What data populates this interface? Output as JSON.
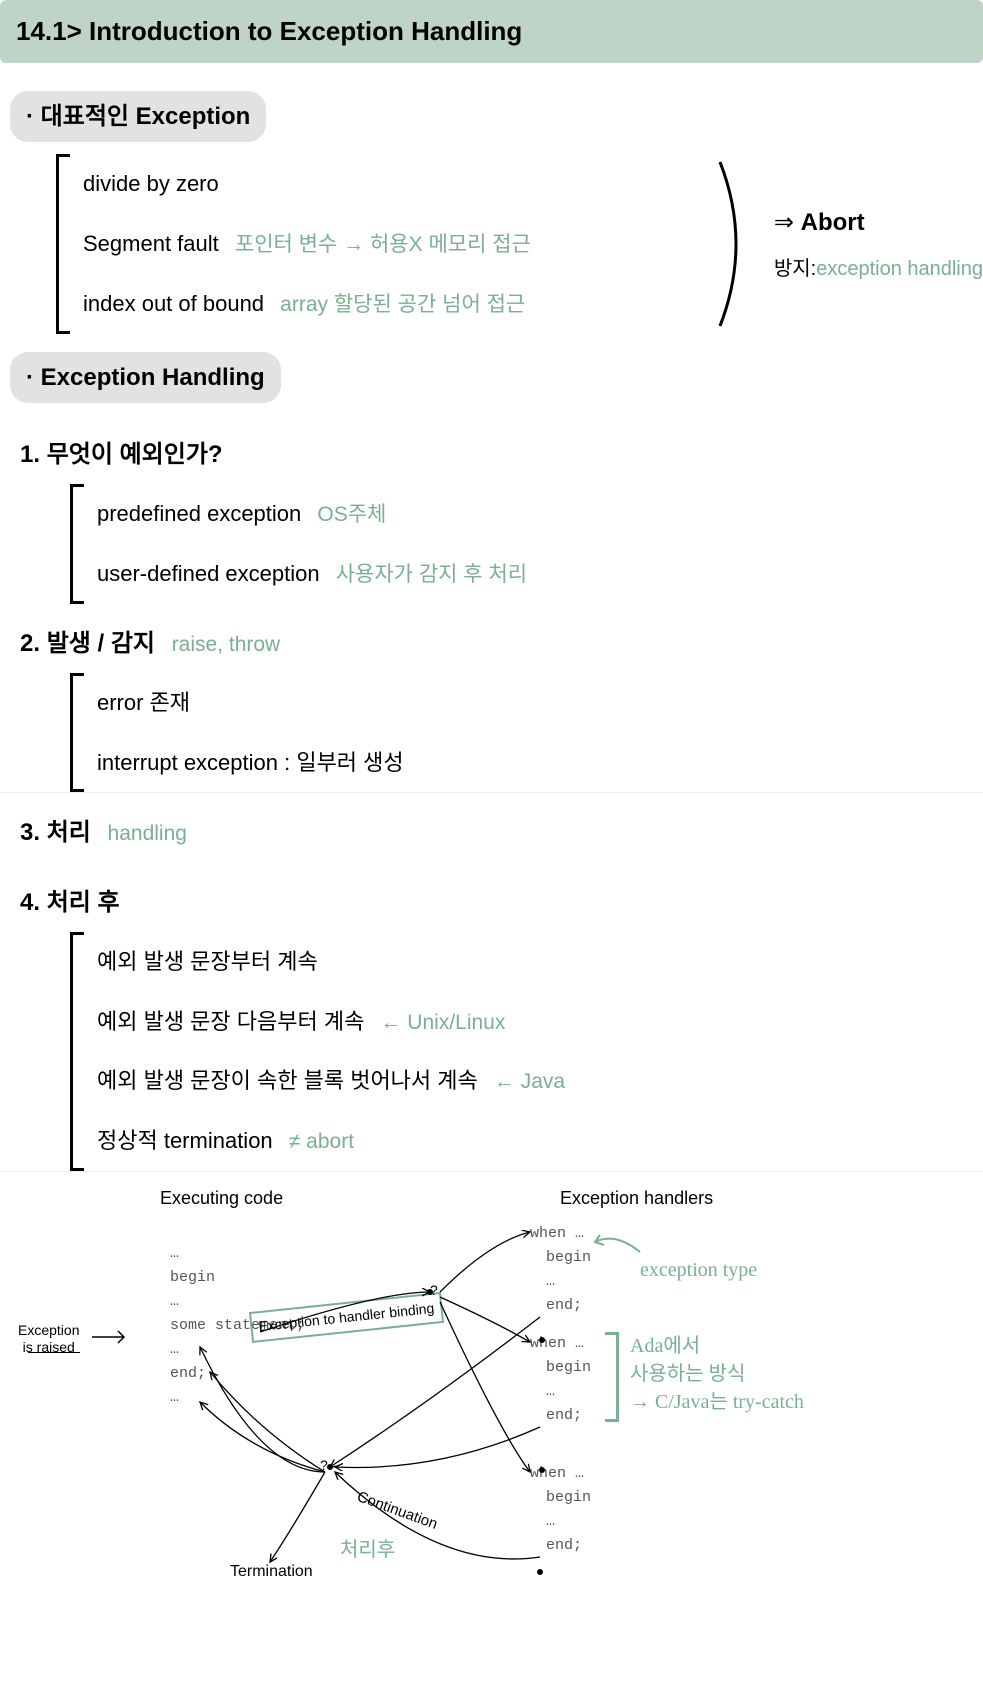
{
  "title": "14.1> Introduction to Exception Handling",
  "section1": {
    "heading": "· 대표적인 Exception",
    "items": [
      {
        "text": "divide by zero",
        "note": ""
      },
      {
        "text": "Segment fault",
        "note": "포인터 변수 → 허용X 메모리 접근"
      },
      {
        "text": "index out of bound",
        "note": "array 할당된 공간 넘어 접근"
      }
    ],
    "result": {
      "arrow": "⇒",
      "main": "Abort",
      "sub_prefix": "방지:",
      "sub": "exception handling"
    }
  },
  "section2": {
    "heading": "· Exception Handling",
    "q1": {
      "num": "1.",
      "title": "무엇이 예외인가?",
      "items": [
        {
          "text": "predefined exception",
          "note": "OS주체"
        },
        {
          "text": "user-defined exception",
          "note": "사용자가 감지 후 처리"
        }
      ]
    },
    "q2": {
      "num": "2.",
      "title": "발생 / 감지",
      "note": "raise, throw",
      "items": [
        {
          "text": "error 존재"
        },
        {
          "text": "interrupt exception : 일부러 생성"
        }
      ]
    },
    "q3": {
      "num": "3.",
      "title": "처리",
      "note": "handling"
    },
    "q4": {
      "num": "4.",
      "title": "처리 후",
      "items": [
        {
          "text": "예외 발생 문장부터 계속",
          "note": ""
        },
        {
          "text": "예외 발생 문장 다음부터 계속",
          "note": "← Unix/Linux"
        },
        {
          "text": "예외 발생 문장이 속한 블록 벗어나서 계속",
          "note": "← Java"
        },
        {
          "text": "정상적 termination",
          "note": "≠ abort"
        }
      ]
    }
  },
  "diagram": {
    "heading_left": "Executing code",
    "heading_right": "Exception handlers",
    "code_left": [
      "…",
      "begin",
      "…",
      "some statement;",
      "…",
      "end;",
      "…"
    ],
    "raised_label": "Exception\nis raised",
    "binding_box": "Exception to handler binding",
    "qmark": "?",
    "termination": "Termination",
    "continuation": "Continuation",
    "cont_note": "처리후",
    "handler_block": [
      "when …",
      "begin",
      "…",
      "end;"
    ],
    "annot_type": "exception type",
    "annot_ada": "Ada에서\n사용하는 방식\n→ C/Java는 try-catch"
  }
}
